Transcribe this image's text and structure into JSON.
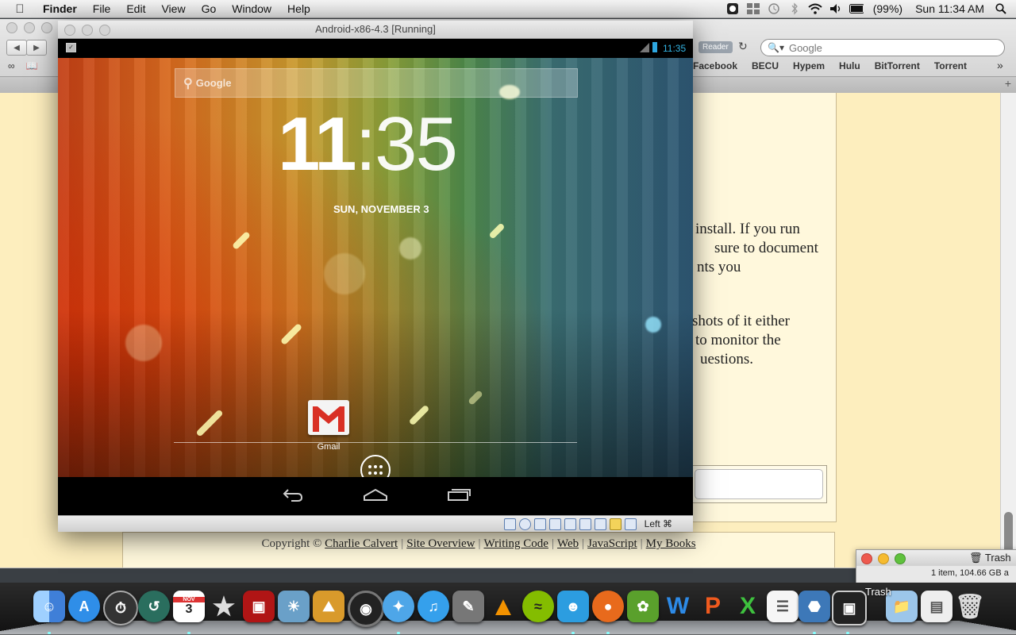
{
  "menubar": {
    "app": "Finder",
    "items": [
      "File",
      "Edit",
      "View",
      "Go",
      "Window",
      "Help"
    ],
    "battery": "(99%)",
    "clock": "Sun 11:34 AM"
  },
  "browser": {
    "search_placeholder": "Google",
    "reader_label": "Reader",
    "bookmarks": [
      "Facebook",
      "BECU",
      "Hypem",
      "Hulu",
      "BitTorrent",
      "Torrent"
    ],
    "article": {
      "p1": [
        " install. If you run",
        "sure to document",
        "nts you"
      ],
      "p2": [
        "shots of it either",
        "to monitor the",
        "uestions."
      ]
    },
    "footer": {
      "copyright": "Copyright ©",
      "links": [
        "Charlie Calvert",
        "Site Overview",
        "Writing Code",
        "Web",
        "JavaScript",
        "My Books"
      ]
    }
  },
  "vbox": {
    "title": "Android-x86-4.3 [Running]",
    "host_key": "Left ⌘",
    "android": {
      "status_time": "11:35",
      "search_label": "Google",
      "clock_hours": "11",
      "clock_sep": ":",
      "clock_minutes": "35",
      "date": "SUN, NOVEMBER 3",
      "gmail_label": "Gmail"
    }
  },
  "trash_window": {
    "title": "Trash",
    "info": "1 item, 104.66 GB a"
  },
  "dock": {
    "trash_label": "Trash",
    "calendar_day": "3",
    "icons": [
      "finder-icon",
      "app-store-icon",
      "dashboard-icon",
      "time-machine-icon",
      "calendar-icon",
      "imovie-icon",
      "photo-booth-icon",
      "iphoto-icon",
      "preview-icon",
      "camera-icon",
      "safari-icon",
      "itunes-icon",
      "script-editor-icon",
      "vlc-icon",
      "spotify-icon",
      "messenger-icon",
      "firefox-icon",
      "evernote-icon",
      "word-icon",
      "powerpoint-icon",
      "excel-icon",
      "textedit-icon",
      "virtualbox-icon",
      "screen-icon",
      "folder-icon",
      "documents-icon",
      "trash-icon"
    ]
  },
  "colors": {
    "page_bg": "#fdeebe",
    "android_accent": "#33b5e5",
    "gmail_red": "#d93025"
  }
}
